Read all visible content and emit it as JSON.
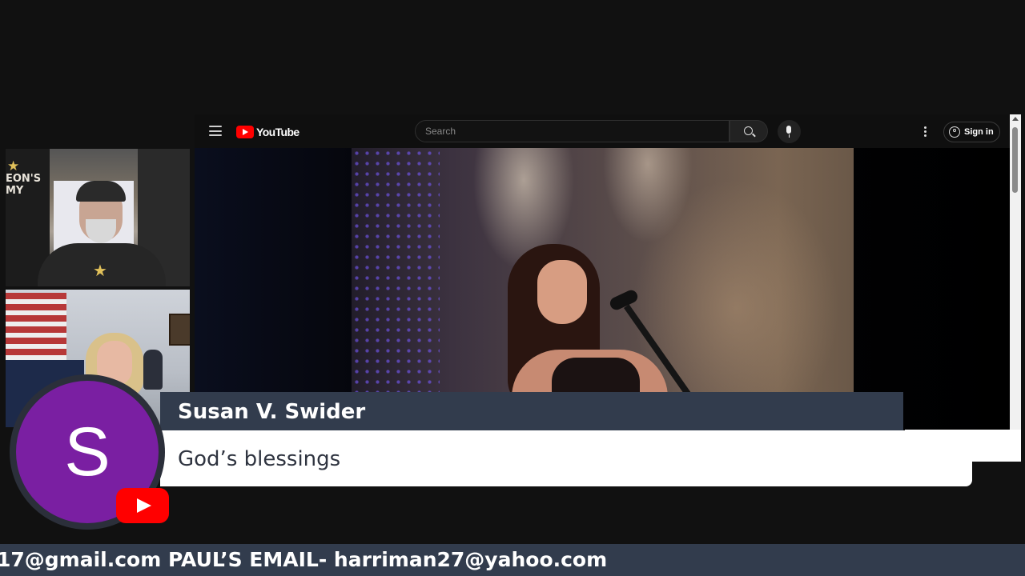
{
  "youtube": {
    "logo_text": "YouTube",
    "search_placeholder": "Search",
    "sign_in_label": "Sign in",
    "icons": {
      "menu": "hamburger-icon",
      "search": "search-icon",
      "voice": "microphone-icon",
      "more": "more-vert-icon",
      "account": "account-icon"
    },
    "brand_color": "#ff0000"
  },
  "comment": {
    "author": "Susan V. Swider",
    "message": "God’s blessings",
    "avatar_letter": "S",
    "avatar_color": "#7a1fa2"
  },
  "ticker": {
    "text": "17@gmail.com PAUL’S EMAIL- harriman27@yahoo.com"
  },
  "webcam_1": {
    "wall_text": "EON'S\nMY"
  },
  "colors": {
    "bar": "#323c4d",
    "background": "#111111"
  }
}
